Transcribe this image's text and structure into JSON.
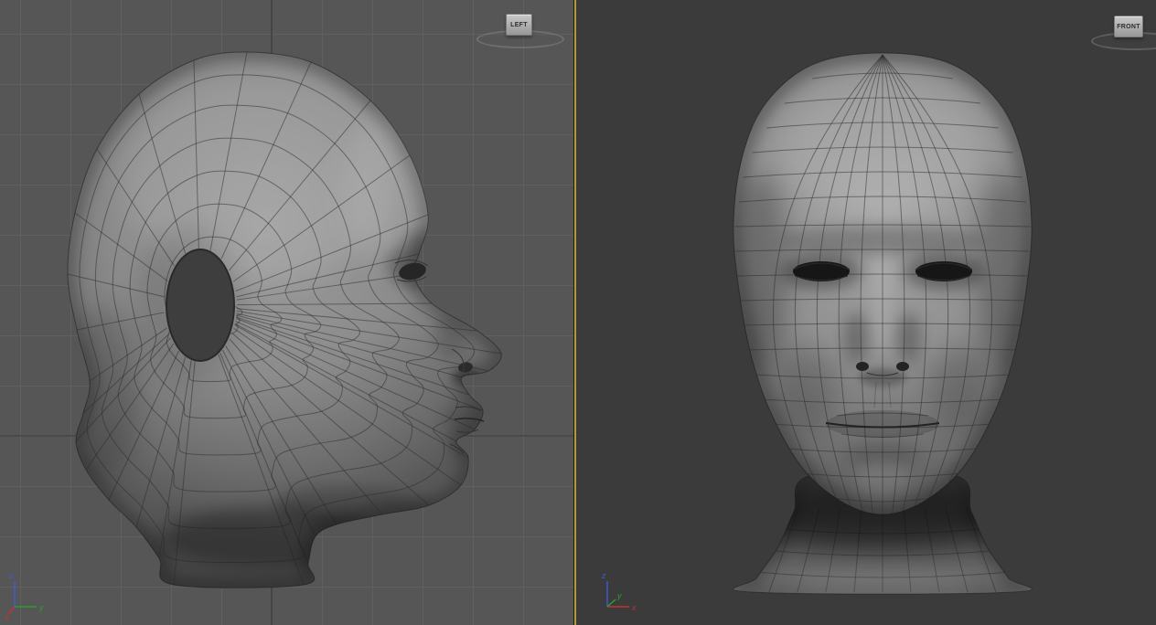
{
  "viewports": [
    {
      "id": "left",
      "label": "LEFT"
    },
    {
      "id": "front",
      "label": "FRONT"
    }
  ],
  "axis_gizmos": {
    "left_viewport": {
      "vertical_axis": "z",
      "horizontal_axis": "y",
      "depth_axis": "x"
    },
    "front_viewport": {
      "vertical_axis": "z",
      "horizontal_axis": "x",
      "depth_axis": "y"
    }
  },
  "colors": {
    "left_viewport_bg": "#565656",
    "right_viewport_bg": "#3b3b3b",
    "grid_line": "#606060",
    "grid_origin_line": "#454545",
    "divider_active": "#b89a37",
    "view_label_bg": "#a9a9a9",
    "wireframe": "#2a2a2a",
    "axis_x": "#c03434",
    "axis_y": "#2f9e2f",
    "axis_z": "#3b5bd0"
  }
}
